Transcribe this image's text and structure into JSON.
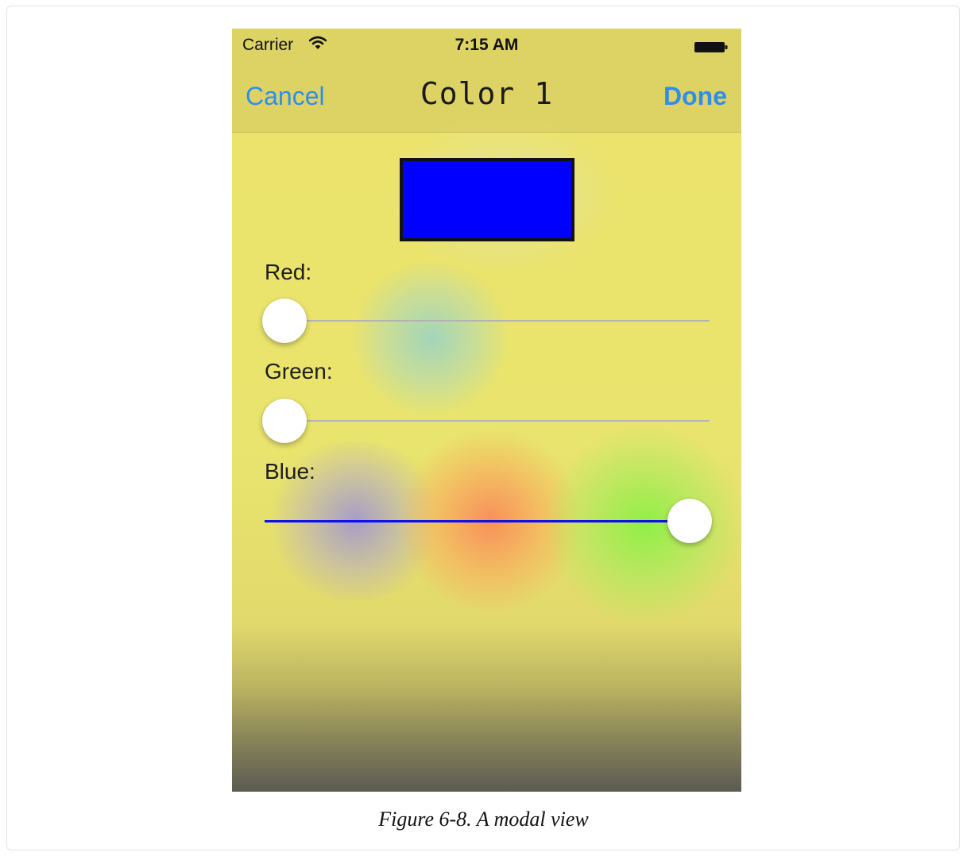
{
  "status_bar": {
    "carrier": "Carrier",
    "wifi_icon": "wifi-icon",
    "time": "7:15 AM",
    "battery_icon": "battery-icon"
  },
  "nav_bar": {
    "cancel_label": "Cancel",
    "title": "Color 1",
    "done_label": "Done"
  },
  "color_preview": {
    "color": "#0000FE"
  },
  "sliders": [
    {
      "label": "Red:",
      "value": 0.0
    },
    {
      "label": "Green:",
      "value": 0.0
    },
    {
      "label": "Blue:",
      "value": 1.0
    }
  ],
  "colors": {
    "accent": "#2F8EE8",
    "background": "#EBE56C",
    "slider_track": "#B5B3B4",
    "slider_min_track_blue": "#1010E8"
  },
  "caption": "Figure 6-8. A modal view"
}
